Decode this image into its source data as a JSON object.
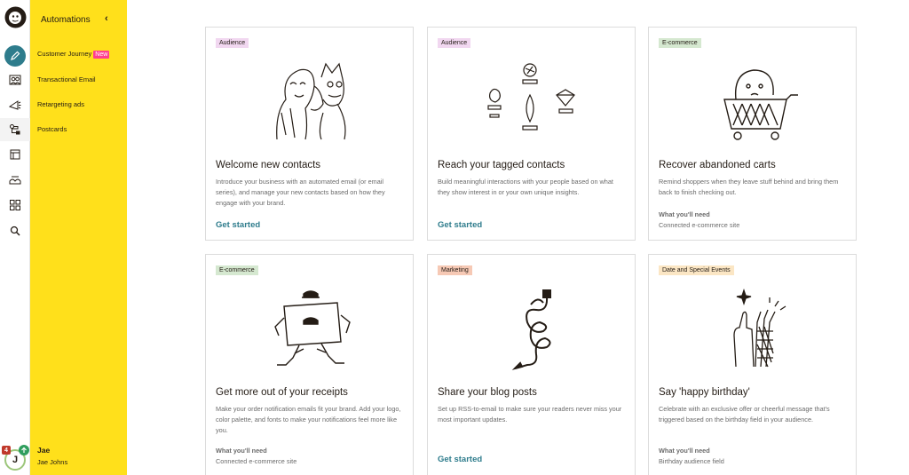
{
  "sidebar": {
    "title": "Automations",
    "items": [
      {
        "label": "Customer Journey",
        "badge": "New"
      },
      {
        "label": "Transactional Email"
      },
      {
        "label": "Retargeting ads"
      },
      {
        "label": "Postcards"
      }
    ],
    "user": {
      "name": "Jae",
      "full_name": "Jae Johns",
      "initial": "J",
      "notification_count": "4"
    }
  },
  "rail_icons": [
    "logo-icon",
    "create-pencil-icon",
    "audience-icon",
    "campaigns-icon",
    "automations-icon",
    "website-icon",
    "content-icon",
    "integrations-icon",
    "search-icon"
  ],
  "cards": [
    {
      "tag": "Audience",
      "title": "Welcome new contacts",
      "description": "Introduce your business with an automated email (or email series), and manage your new contacts based on how they engage with your brand.",
      "cta": "Get started"
    },
    {
      "tag": "Audience",
      "title": "Reach your tagged contacts",
      "description": "Build meaningful interactions with your people based on what they show interest in or your own unique insights.",
      "cta": "Get started"
    },
    {
      "tag": "E-commerce",
      "title": "Recover abandoned carts",
      "description": "Remind shoppers when they leave stuff behind and bring them back to finish checking out.",
      "need_heading": "What you'll need",
      "need_value": "Connected e-commerce site"
    },
    {
      "tag": "E-commerce",
      "title": "Get more out of your receipts",
      "description": "Make your order notification emails fit your brand. Add your logo, color palette, and fonts to make your notifications feel more like you.",
      "need_heading": "What you'll need",
      "need_value": "Connected e-commerce site"
    },
    {
      "tag": "Marketing",
      "title": "Share your blog posts",
      "description": "Set up RSS-to-email to make sure your readers never miss your most important updates.",
      "cta": "Get started"
    },
    {
      "tag": "Date and Special Events",
      "title": "Say 'happy birthday'",
      "description": "Celebrate with an exclusive offer or cheerful message that's triggered based on the birthday field in your audience.",
      "need_heading": "What you'll need",
      "need_value": "Birthday audience field"
    }
  ]
}
